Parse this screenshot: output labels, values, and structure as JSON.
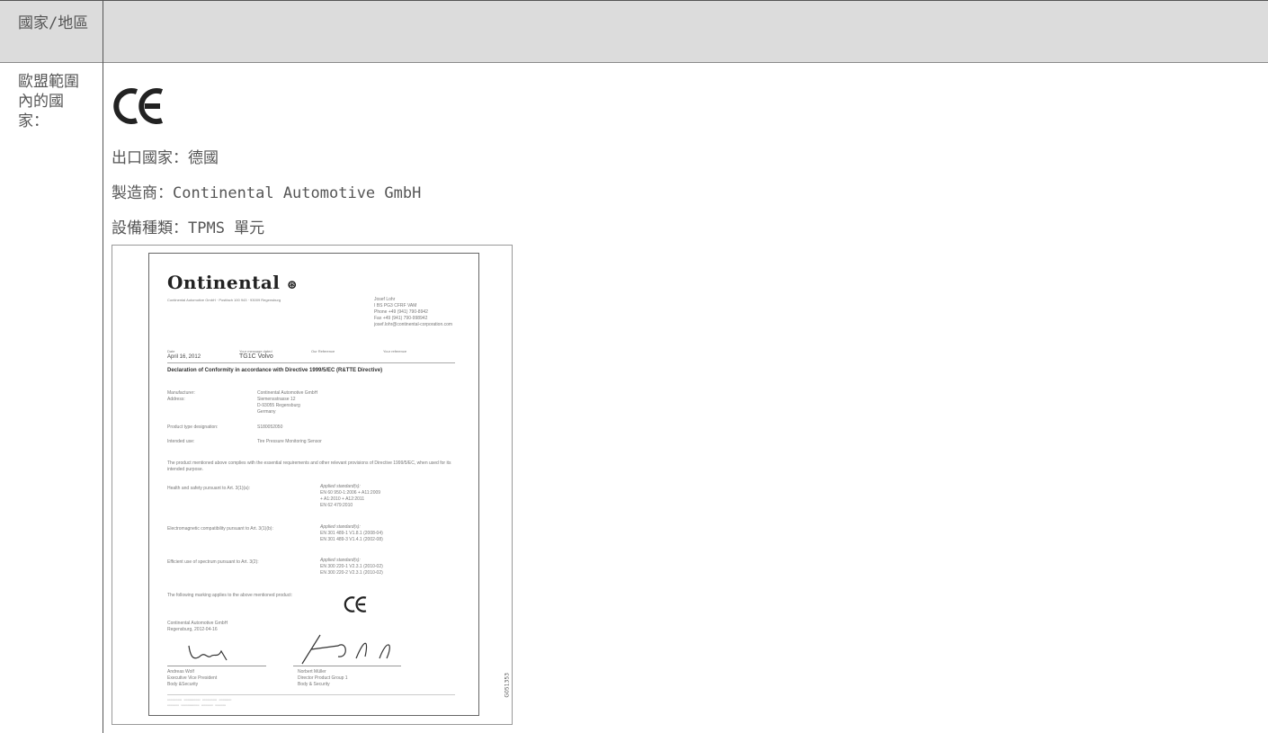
{
  "header": {
    "col1_label": "國家/地區"
  },
  "row": {
    "label": "歐盟範圍內的國家：",
    "export_country": "出口國家：德國",
    "manufacturer": "製造商：Continental Automotive GmbH",
    "equipment_type": "設備種類：TPMS 單元"
  },
  "document": {
    "logo": "Ontinental",
    "contact": [
      "Josef Lohr",
      "I BS PG3 CFRF VAM",
      "Phone +49 (941) 790-8942",
      "Fax +49 (941) 790-998942",
      "josef.lohr@continental-corporation.com"
    ],
    "date_label": "Date",
    "date": "April 16, 2012",
    "msg_label": "Your message dated",
    "msg": "TG1C Volvo",
    "ref_label": "Our Reference",
    "your_ref_label": "Your reference",
    "heading": "Declaration of Conformity in accordance with Directive 1999/5/EC (R&TTE Directive)",
    "manufacturer_label": "Manufacturer:",
    "address_label": "Address:",
    "manufacturer_lines": [
      "Continental Automotive GmbH",
      "Siemensstrasse 12",
      "D-93055 Regensburg",
      "Germany"
    ],
    "product_label": "Product type designation:",
    "product": "S180052050",
    "use_label": "Intended use:",
    "use": "Tire Pressure Monitoring Sensor",
    "compliance": "The product mentioned above complies with the essential requirements and other relevant provisions of Directive 1999/5/EC, when used for its intended purpose.",
    "health_label": "Health and safety pursuant to Art. 3(1)(a):",
    "health_std": [
      "Applied standard(s):",
      "EN 60 950-1:2006 + A11:2009",
      "+ A1:2010 + A12:2011",
      "EN 62 479:2010"
    ],
    "emc_label": "Electromagnetic compatibility pursuant to Art. 3(1)(b):",
    "emc_std": [
      "Applied standard(s):",
      "EN 301 489-1 V1.8.1 (2008-04)",
      "EN 301 489-3 V1.4.1 (2002-08)"
    ],
    "spectrum_label": "Efficient use of spectrum pursuant to Art. 3(2):",
    "spectrum_std": [
      "Applied standard(s):",
      "EN 300 220-1 V2.3.1 (2010-02)",
      "EN 300 220-2 V2.3.1 (2010-02)"
    ],
    "marking": "The following marking applies to the above mentioned product:",
    "place": [
      "Continental Automotive GmbH",
      "Regensburg, 2012-04-16"
    ],
    "signer1": [
      "Andreas Wolf",
      "Executive Vice President",
      "Body &Security"
    ],
    "signer2": [
      "Norbert Müller",
      "Director Product Group 1",
      "Body & Security"
    ],
    "doc_id": "G051353"
  }
}
